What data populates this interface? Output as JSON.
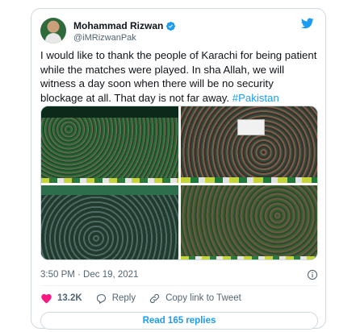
{
  "author": {
    "name": "Mohammad Rizwan",
    "handle": "@iMRizwanPak"
  },
  "tweet": {
    "text": "I would like to thank the people of Karachi for being patient while the matches were played. In sha Allah, we will witness a day soon when there will be no security blockage at all. That day is not far away.",
    "hashtag": "#Pakistan",
    "timestamp": "3:50 PM · Dec 19, 2021"
  },
  "actions": {
    "likes": "13.2K",
    "reply_label": "Reply",
    "copy_link_label": "Copy link to Tweet"
  },
  "replies_button": "Read 165 replies",
  "colors": {
    "accent": "#1d9bf0",
    "like_red": "#f91880",
    "text_primary": "#0f1419",
    "text_secondary": "#536471",
    "border": "#cfd9de"
  },
  "icons": [
    "verified-badge-icon",
    "twitter-bird-icon",
    "info-icon",
    "heart-icon",
    "reply-icon",
    "link-icon"
  ]
}
